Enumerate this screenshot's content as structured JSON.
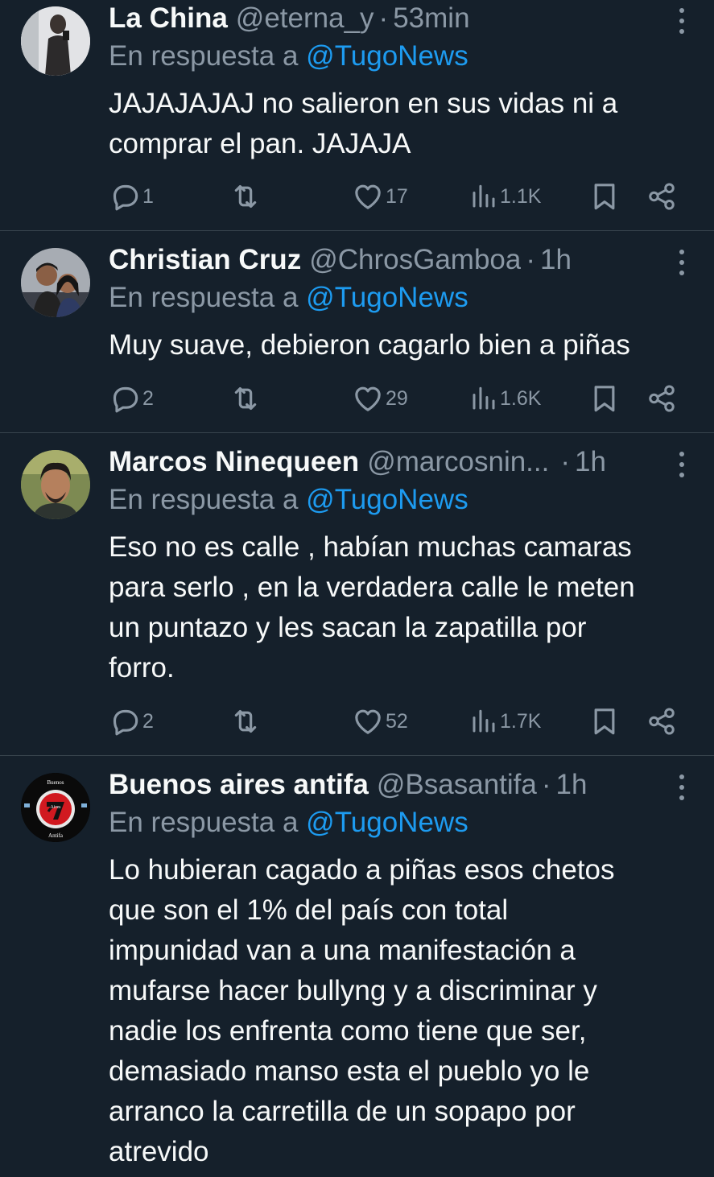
{
  "colors": {
    "background": "#15202b",
    "text": "#f7f9f9",
    "muted": "#8b98a5",
    "link": "#1d9bf0",
    "separator": "#38444d"
  },
  "tweets": [
    {
      "name": "La China",
      "handle": "@eterna_y",
      "dot": "·",
      "time": "53min",
      "reply_prefix": "En respuesta a",
      "reply_to": "@TugoNews",
      "text": "JAJAJAJAJ no salieron en sus vidas ni a\ncomprar el pan. JAJAJA",
      "replies": "1",
      "likes": "17",
      "views": "1.1K"
    },
    {
      "name": "Christian Cruz",
      "handle": "@ChrosGamboa",
      "dot": "·",
      "time": "1h",
      "reply_prefix": "En respuesta a",
      "reply_to": "@TugoNews",
      "text": "Muy suave, debieron cagarlo bien a piñas",
      "replies": "2",
      "likes": "29",
      "views": "1.6K"
    },
    {
      "name": "Marcos Ninequeen",
      "handle": "@marcosnin...",
      "dot": "·",
      "time": "1h",
      "reply_prefix": "En respuesta a",
      "reply_to": "@TugoNews",
      "text": "Eso no es calle , habían muchas camaras\npara serlo , en la verdadera calle le meten\nun puntazo y les sacan la zapatilla por\nforro.",
      "replies": "2",
      "likes": "52",
      "views": "1.7K"
    },
    {
      "name": "Buenos aires antifa",
      "handle": "@Bsasantifa",
      "dot": "·",
      "time": "1h",
      "reply_prefix": "En respuesta a",
      "reply_to": "@TugoNews",
      "text": "Lo hubieran cagado a piñas esos chetos\nque son el 1% del país con total\nimpunidad van a una manifestación a\nmufarse hacer bullyng y a discriminar y\nnadie los enfrenta como tiene que ser,\ndemasiado manso esta el pueblo yo le\narranco la carretilla de un sopapo por\natrevido",
      "avatar_logo_text": [
        "Buenos",
        "Aires",
        "Antifa"
      ]
    }
  ]
}
